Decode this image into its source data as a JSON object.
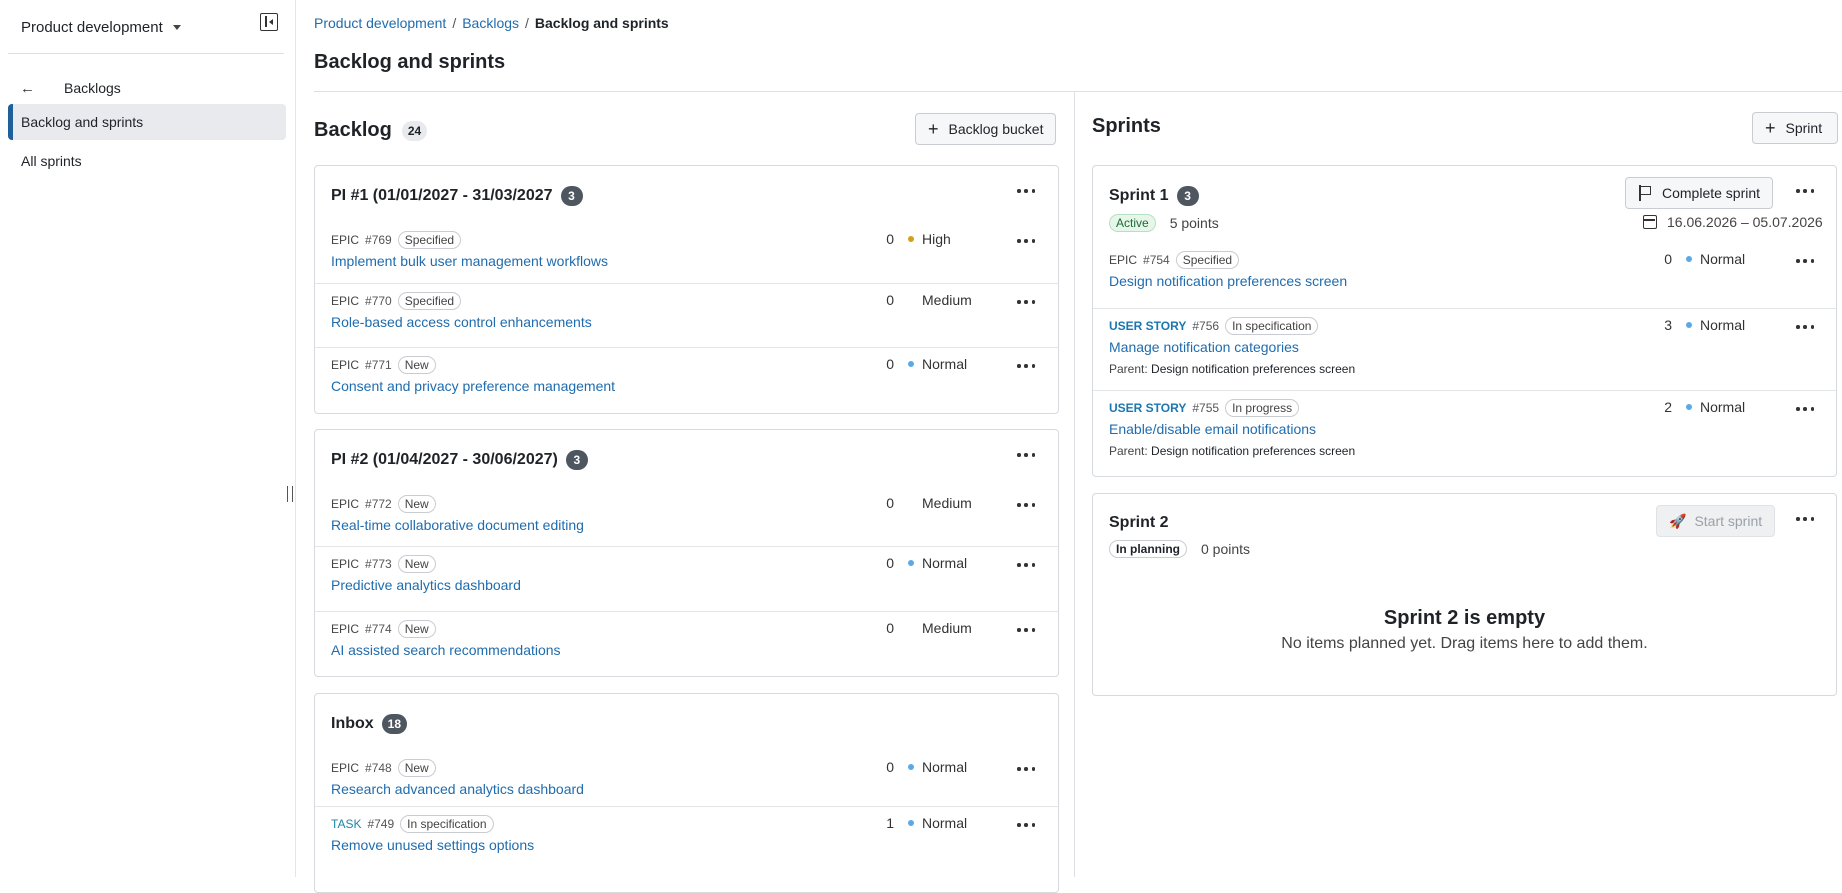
{
  "sidebar": {
    "project": "Product development",
    "back_label": "Backlogs",
    "items": [
      {
        "label": "Backlog and sprints"
      },
      {
        "label": "All sprints"
      }
    ]
  },
  "breadcrumb": {
    "items": [
      "Product development",
      "Backlogs"
    ],
    "separator": "/",
    "current": "Backlog and sprints"
  },
  "page_title": "Backlog and sprints",
  "backlog": {
    "title": "Backlog",
    "count": "24",
    "add_label": "Backlog bucket",
    "buckets": [
      {
        "title": "PI #1 (01/01/2027 - 31/03/2027",
        "count": "3",
        "items": [
          {
            "type": "EPIC",
            "id": "#769",
            "status": "Specified",
            "subject": "Implement bulk user management workflows",
            "points": "0",
            "priority": "High",
            "prio_color": "#d4a017"
          },
          {
            "type": "EPIC",
            "id": "#770",
            "status": "Specified",
            "subject": "Role-based access control enhancements",
            "points": "0",
            "priority": "Medium",
            "prio_color": ""
          },
          {
            "type": "EPIC",
            "id": "#771",
            "status": "New",
            "subject": "Consent and privacy preference management",
            "points": "0",
            "priority": "Normal",
            "prio_color": "#5aa9e6"
          }
        ]
      },
      {
        "title": "PI #2 (01/04/2027 - 30/06/2027)",
        "count": "3",
        "items": [
          {
            "type": "EPIC",
            "id": "#772",
            "status": "New",
            "subject": "Real-time collaborative document editing",
            "points": "0",
            "priority": "Medium",
            "prio_color": ""
          },
          {
            "type": "EPIC",
            "id": "#773",
            "status": "New",
            "subject": "Predictive analytics dashboard",
            "points": "0",
            "priority": "Normal",
            "prio_color": "#5aa9e6"
          },
          {
            "type": "EPIC",
            "id": "#774",
            "status": "New",
            "subject": "AI assisted search recommendations",
            "points": "0",
            "priority": "Medium",
            "prio_color": ""
          }
        ]
      },
      {
        "title": "Inbox",
        "count": "18",
        "items": [
          {
            "type": "EPIC",
            "id": "#748",
            "status": "New",
            "subject": "Research advanced analytics dashboard",
            "points": "0",
            "priority": "Normal",
            "prio_color": "#5aa9e6"
          },
          {
            "type": "TASK",
            "id": "#749",
            "status": "In specification",
            "subject": "Remove unused settings options",
            "points": "1",
            "priority": "Normal",
            "prio_color": "#5aa9e6"
          }
        ]
      }
    ]
  },
  "sprints": {
    "title": "Sprints",
    "add_label": "Sprint",
    "list": [
      {
        "name": "Sprint 1",
        "count": "3",
        "state": "Active",
        "points": "5 points",
        "action": "Complete sprint",
        "dates": "16.06.2026 – 05.07.2026",
        "items": [
          {
            "type": "EPIC",
            "id": "#754",
            "status": "Specified",
            "subject": "Design notification preferences screen",
            "points": "0",
            "priority": "Normal",
            "prio_color": "#5aa9e6"
          },
          {
            "type": "USER STORY",
            "id": "#756",
            "status": "In specification",
            "subject": "Manage notification categories",
            "parent_label": "Parent:",
            "parent": "Design notification preferences screen",
            "points": "3",
            "priority": "Normal",
            "prio_color": "#5aa9e6"
          },
          {
            "type": "USER STORY",
            "id": "#755",
            "status": "In progress",
            "subject": "Enable/disable email notifications",
            "parent_label": "Parent:",
            "parent": "Design notification preferences screen",
            "points": "2",
            "priority": "Normal",
            "prio_color": "#5aa9e6"
          }
        ]
      },
      {
        "name": "Sprint 2",
        "state": "In planning",
        "points": "0 points",
        "action": "Start sprint",
        "empty_title": "Sprint 2 is empty",
        "empty_desc": "No items planned yet. Drag items here to add them."
      }
    ]
  },
  "colors": {
    "accent": "#1f5f9a",
    "link": "#1f6cae",
    "prio_high": "#d4a017",
    "prio_normal": "#5aa9e6"
  }
}
